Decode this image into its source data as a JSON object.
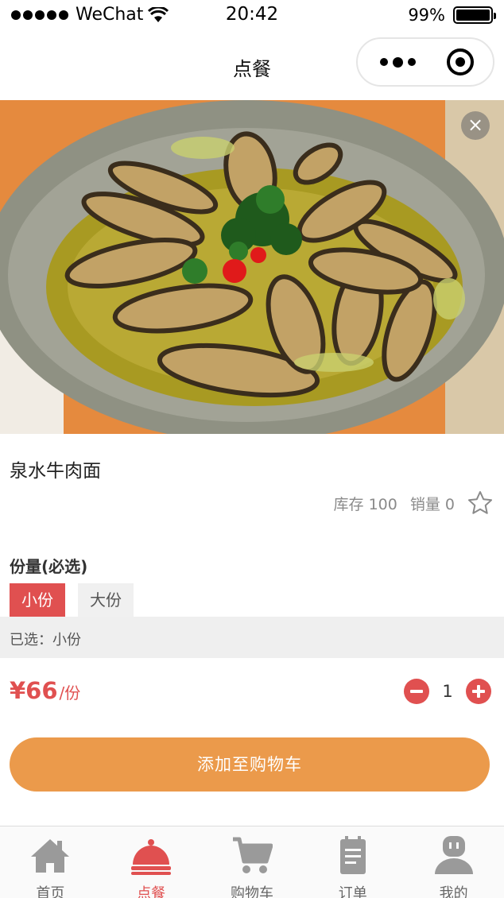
{
  "status_bar": {
    "carrier": "WeChat",
    "time": "20:42",
    "battery": "99%",
    "battery_level": 0.99
  },
  "nav": {
    "title": "点餐"
  },
  "product": {
    "name": "泉水牛肉面",
    "stock": "库存 100",
    "sales": "销量 0"
  },
  "options": {
    "title": "份量(必选)",
    "items": [
      {
        "label": "小份",
        "selected": true
      },
      {
        "label": "大份",
        "selected": false
      }
    ],
    "selected_text": "已选：小份"
  },
  "price": {
    "value": "¥66",
    "unit": "/份"
  },
  "quantity": "1",
  "add_to_cart": "添加至购物车",
  "tabs": [
    {
      "label": "首页",
      "icon": "home-icon",
      "active": false
    },
    {
      "label": "点餐",
      "icon": "cloche-icon",
      "active": true
    },
    {
      "label": "购物车",
      "icon": "cart-icon",
      "active": false
    },
    {
      "label": "订单",
      "icon": "order-icon",
      "active": false
    },
    {
      "label": "我的",
      "icon": "profile-icon",
      "active": false
    }
  ],
  "colors": {
    "accent": "#e05050",
    "button": "#eb9a4b",
    "tab_inactive": "#9a9a9a"
  }
}
